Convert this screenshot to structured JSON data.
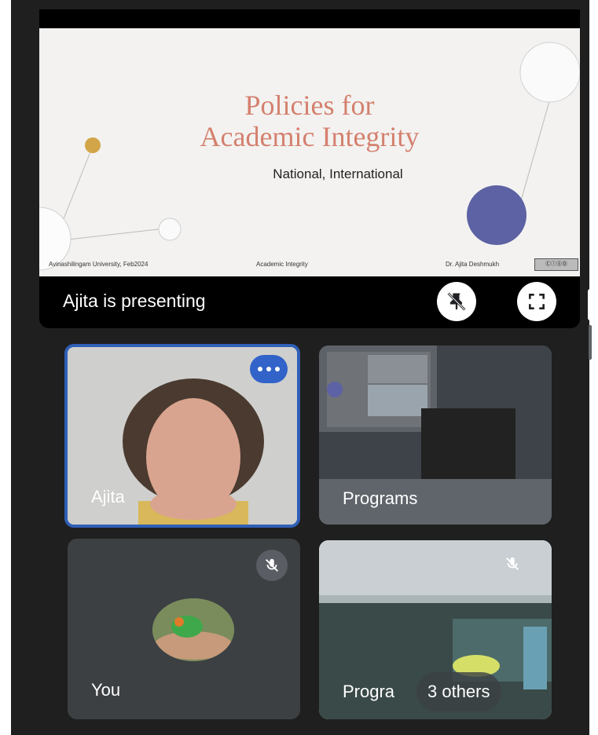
{
  "slide": {
    "title_line1": "Policies for",
    "title_line2": "Academic Integrity",
    "subtitle": "National, International",
    "footer_left": "Avinashilingam University, Feb2024",
    "footer_center": "Academic Integrity",
    "footer_right": "Dr. Ajita Deshmukh"
  },
  "presentation": {
    "presenting_text": "Ajita is presenting",
    "unpin_icon": "pin-off-icon",
    "fullscreen_icon": "fullscreen-icon"
  },
  "tiles": [
    {
      "name": "Ajita",
      "active_speaker": true,
      "menu_icon": "more-horiz-icon"
    },
    {
      "name": "Programs"
    },
    {
      "name": "You",
      "muted": true
    },
    {
      "name": "Progra",
      "extra": "3 others",
      "muted": true
    }
  ],
  "colors": {
    "active_border": "#2f5fb7",
    "title_accent": "#d4806e"
  }
}
